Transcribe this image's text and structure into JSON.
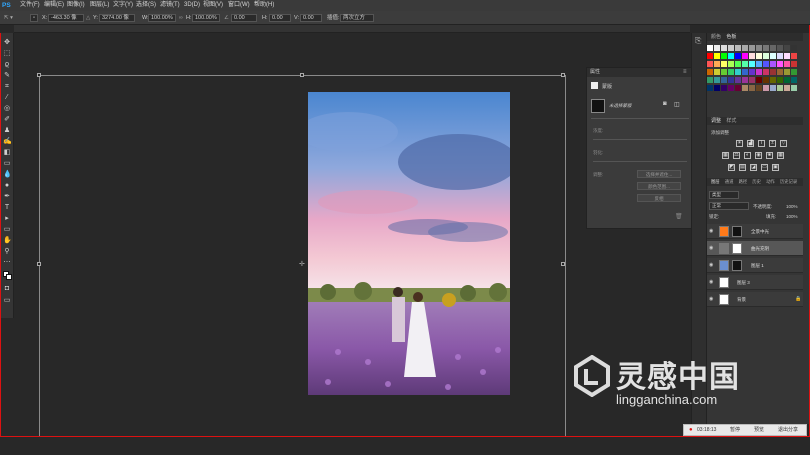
{
  "menubar": {
    "logo": "PS",
    "items": [
      "文件(F)",
      "编辑(E)",
      "图像(I)",
      "图层(L)",
      "文字(Y)",
      "选择(S)",
      "滤镜(T)",
      "3D(D)",
      "视图(V)",
      "窗口(W)",
      "帮助(H)"
    ]
  },
  "options": {
    "x_label": "X:",
    "x_value": "-463.30 像",
    "y_label": "Y:",
    "y_value": "3274.00 像",
    "w_label": "W:",
    "w_value": "100.00%",
    "h_label": "H:",
    "h_value": "100.00%",
    "angle_value": "0.00",
    "h2_label": "H:",
    "h2_value": "0.00",
    "v_label": "V:",
    "v_value": "0.00",
    "interp_label": "插值:",
    "interp_value": "两次立方"
  },
  "properties": {
    "title": "属性",
    "subtitle": "蒙版",
    "mask_name": "未选择蒙版",
    "density": "浓度:",
    "feather": "羽化:",
    "refine": "调整:",
    "btn_select": "选择并遮住...",
    "btn_range": "颜色范围...",
    "btn_invert": "反相"
  },
  "swatches_tabs": [
    "颜色",
    "色板"
  ],
  "adjust_tabs": [
    "调整",
    "样式"
  ],
  "adjust_title": "添加调整",
  "layers_tabs": [
    "图层",
    "通道",
    "路径",
    "历史",
    "动作",
    "历史记录"
  ],
  "layers_filter": "类型",
  "layers_mode": "正常",
  "opacity_label": "不透明度:",
  "opacity_value": "100%",
  "lock_label": "锁定:",
  "fill_label": "填充:",
  "fill_value": "100%",
  "layers": [
    {
      "name": "全景中光"
    },
    {
      "name": "曲光充阴"
    },
    {
      "name": "图层 1"
    },
    {
      "name": "图层 3"
    },
    {
      "name": "背景"
    }
  ],
  "watermark": {
    "cn": "灵感中国",
    "url": "lingganchina.com"
  },
  "statusbar": {
    "time": "03:18:13",
    "pause": "暂停",
    "preview": "预览",
    "exit": "退出分享"
  },
  "colors": {
    "accent": "#31a8ff",
    "record": "#d11111"
  }
}
